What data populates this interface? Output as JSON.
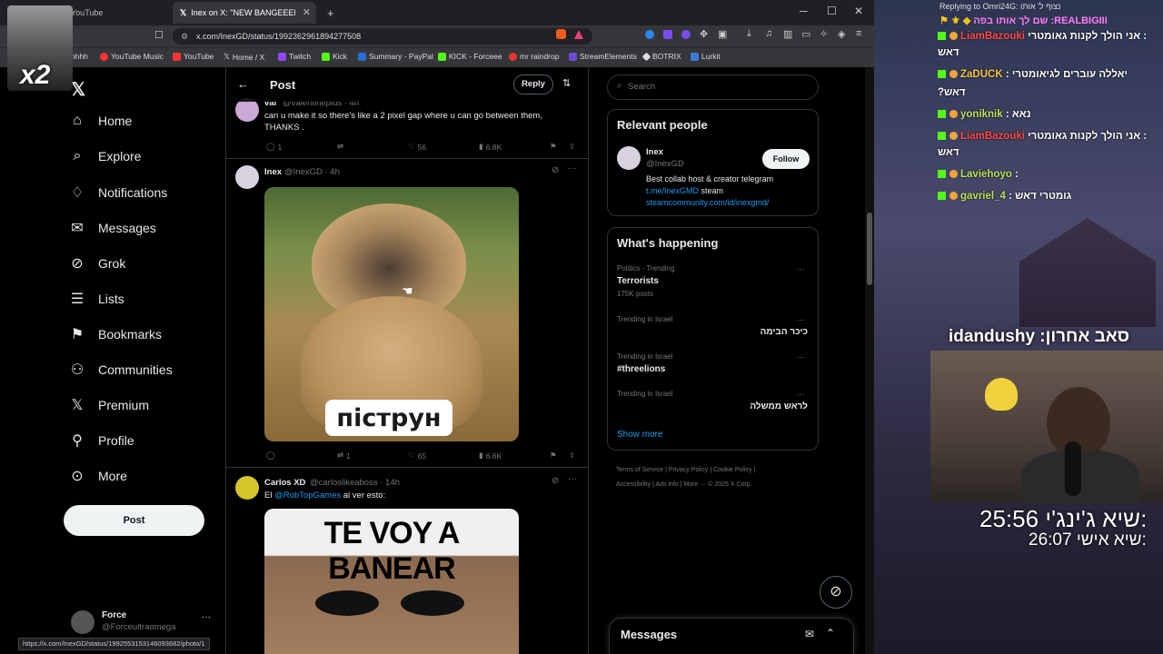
{
  "browser": {
    "tabs": [
      {
        "label": "YouTube"
      },
      {
        "label": "Inex on X: \"NEW BANGEEEEEEE"
      }
    ],
    "new_tab": "+",
    "url": "x.com/InexGD/status/1992362961894277508",
    "bookmarks": [
      "hhhh",
      "YouTube Music",
      "YouTube",
      "Home / X",
      "Twitch",
      "Kick",
      "Summary - PayPal",
      "KICK - Forceee",
      "mr raindrop",
      "StreamElements",
      "BOTRIX",
      "Lurkit"
    ],
    "status_url": "https://x.com/InexGD/status/1992553153146093682/photo/1"
  },
  "nav": {
    "items": [
      "Home",
      "Explore",
      "Notifications",
      "Messages",
      "Grok",
      "Lists",
      "Bookmarks",
      "Communities",
      "Premium",
      "Profile",
      "More"
    ],
    "post_label": "Post",
    "account_name": "Force",
    "account_handle": "@Forceultraomega"
  },
  "header": {
    "title": "Post",
    "reply_label": "Reply"
  },
  "tweets": [
    {
      "name": "val",
      "handle": "@valentinepius · 4h",
      "text_line1": "can u make it so there's like a 2 pixel gap where u can go between them,",
      "text_line2": "THANKS .",
      "replies": "1",
      "likes": "56",
      "views": "6.8K"
    },
    {
      "name": "Inex",
      "handle": "@InexGD · 4h",
      "image_caption": "піструн",
      "replies": "",
      "retweets": "1",
      "likes": "65",
      "views": "6.6K"
    },
    {
      "name": "Carlos XD",
      "handle": "@carloslikeaboss · 14h",
      "text_prefix": "El",
      "mention": "@RobTopGames",
      "text_suffix": "al ver esto:",
      "image_caption": "TE VOY A BANEAR"
    }
  ],
  "search": {
    "placeholder": "Search"
  },
  "relevant": {
    "title": "Relevant people",
    "name": "Inex",
    "handle": "@InexGD",
    "follow_label": "Follow",
    "bio_line1": "Best collab host & creator telegram",
    "bio_link1": "t.me/InexGMD",
    "bio_text2": "steam",
    "bio_link2": "steamcommunity.com/id/inexgmd/"
  },
  "happening": {
    "title": "What's happening",
    "trends": [
      {
        "context": "Politics · Trending",
        "topic": "Terrorists",
        "posts": "175K posts"
      },
      {
        "context": "Trending in Israel",
        "topic": "כיכר הבימה",
        "posts": ""
      },
      {
        "context": "Trending in Israel",
        "topic": "#threelions",
        "posts": ""
      },
      {
        "context": "Trending in Israel",
        "topic": "לראש ממשלה",
        "posts": ""
      }
    ],
    "show_more": "Show more"
  },
  "footer": {
    "line1": "Terms of Service  |  Privacy Policy  |  Cookie Policy  |",
    "line2": "Accessibility  |  Ads info  |  More ···  © 2025 X Corp."
  },
  "messages_drawer": {
    "title": "Messages"
  },
  "overlay": {
    "x2": "x2",
    "replying": "Replying to Omri24G: נצוף ל' אותו",
    "pinned_text": "שם לך אותו בפה :REALBIGIII",
    "chat": [
      {
        "user": "LiamBazouki",
        "text": "אני הולך לקנות גאומטרי :",
        "cont": "דאש",
        "red": true
      },
      {
        "user": "ZaDUCK",
        "text": ": יאללה עוברים לגיאומטרי",
        "cont": "?דאש",
        "red": false
      },
      {
        "user": "yoniknik",
        "text": ": נאא",
        "cont": "",
        "red": false
      },
      {
        "user": "LiamBazouki",
        "text": "אני הולך לקנות גאומטרי :",
        "cont": "דאש",
        "red": true
      },
      {
        "user": "Laviehoyo",
        "text": ":",
        "cont": "",
        "red": false
      },
      {
        "user": "gavriel_4",
        "text": ": גומטרי דאש",
        "cont": "",
        "red": false
      }
    ],
    "last_sub": "idandushy :סאב אחרון",
    "timer1_label": "שיא ג'ינג'י:",
    "timer1_value": "25:56",
    "timer2_label": "שיא אישי:",
    "timer2_value": "26:07"
  }
}
